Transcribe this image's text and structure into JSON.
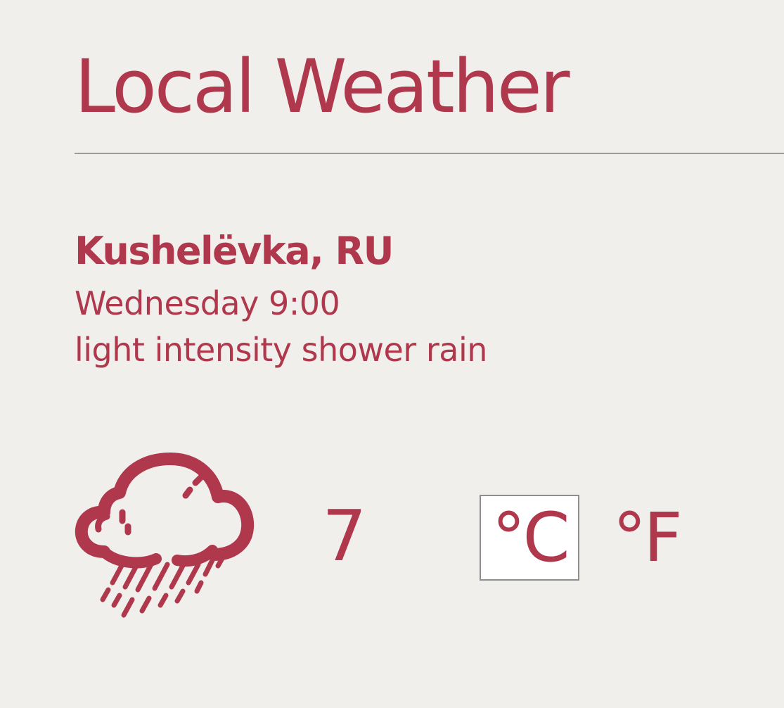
{
  "header": {
    "title": "Local Weather"
  },
  "weather": {
    "location": "Kushelëvka, RU",
    "datetime": "Wednesday 9:00",
    "description": "light intensity shower rain",
    "icon": "rain-cloud-icon",
    "temperature": "7"
  },
  "units": {
    "celsius_label": "°C",
    "fahrenheit_label": "°F",
    "selected": "celsius"
  },
  "colors": {
    "accent": "#b0384c",
    "background": "#f0efec",
    "divider": "#9b9b9b"
  }
}
